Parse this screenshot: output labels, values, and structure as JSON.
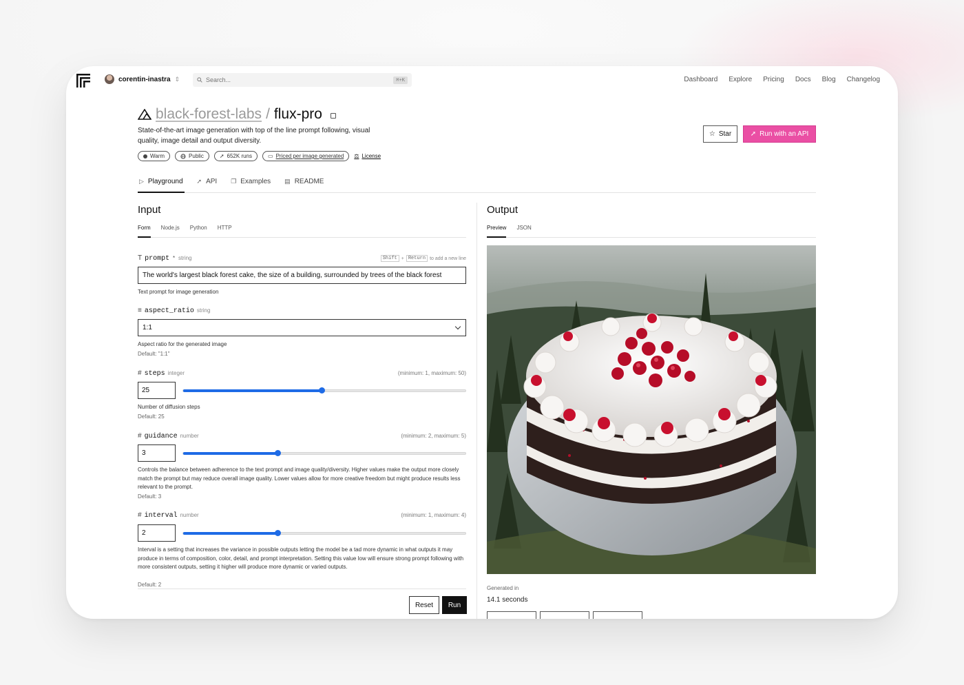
{
  "nav": {
    "username": "corentin-inastra",
    "search_placeholder": "Search...",
    "search_shortcut": "⌘+K",
    "links": [
      "Dashboard",
      "Explore",
      "Pricing",
      "Docs",
      "Blog",
      "Changelog"
    ]
  },
  "header": {
    "org": "black-forest-labs",
    "separator": "/",
    "model": "flux-pro",
    "description": "State-of-the-art image generation with top of the line prompt following, visual quality, image detail and output diversity.",
    "badges": {
      "warm": "Warm",
      "public": "Public",
      "runs": "652K runs",
      "priced": "Priced per image generated",
      "license": "License"
    },
    "star_label": "Star",
    "api_label": "Run with an API"
  },
  "tabs": [
    "Playground",
    "API",
    "Examples",
    "README"
  ],
  "input": {
    "heading": "Input",
    "subtabs": [
      "Form",
      "Node.js",
      "Python",
      "HTTP"
    ],
    "prompt": {
      "name": "prompt",
      "required_mark": "*",
      "type": "string",
      "hint_key1": "Shift",
      "hint_plus": "+",
      "hint_key2": "Return",
      "hint_text": "to add a new line",
      "value": "The world's largest black forest cake, the size of a building, surrounded by trees of the black forest",
      "help": "Text prompt for image generation"
    },
    "aspect_ratio": {
      "name": "aspect_ratio",
      "type": "string",
      "value": "1:1",
      "help": "Aspect ratio for the generated image",
      "default": "Default: \"1:1\""
    },
    "steps": {
      "name": "steps",
      "type": "integer",
      "range": "(minimum: 1, maximum: 50)",
      "value": "25",
      "min": 1,
      "max": 50,
      "num": 25,
      "help": "Number of diffusion steps",
      "default": "Default: 25"
    },
    "guidance": {
      "name": "guidance",
      "type": "number",
      "range": "(minimum: 2, maximum: 5)",
      "value": "3",
      "min": 2,
      "max": 5,
      "num": 3,
      "help": "Controls the balance between adherence to the text prompt and image quality/diversity. Higher values make the output more closely match the prompt but may reduce overall image quality. Lower values allow for more creative freedom but might produce results less relevant to the prompt.",
      "default": "Default: 3"
    },
    "interval": {
      "name": "interval",
      "type": "number",
      "range": "(minimum: 1, maximum: 4)",
      "value": "2",
      "min": 1,
      "max": 4,
      "num": 2,
      "help": "Interval is a setting that increases the variance in possible outputs letting the model be a tad more dynamic in what outputs it may produce in terms of composition, color, detail, and prompt interpretation. Setting this value low will ensure strong prompt following with more consistent outputs, setting it higher will produce more dynamic or varied outputs.",
      "default": "Default: 2"
    },
    "reset_label": "Reset",
    "run_label": "Run"
  },
  "output": {
    "heading": "Output",
    "subtabs": [
      "Preview",
      "JSON"
    ],
    "generated_label": "Generated in",
    "generated_value": "14.1 seconds",
    "colors": {
      "cake_cream": "#f4f1ee",
      "cake_sponge": "#3a2522",
      "berry": "#c8102e",
      "forest": "#2e3d2c"
    }
  },
  "colors": {
    "accent": "#ea4fa4",
    "slider": "#1e6be6"
  }
}
